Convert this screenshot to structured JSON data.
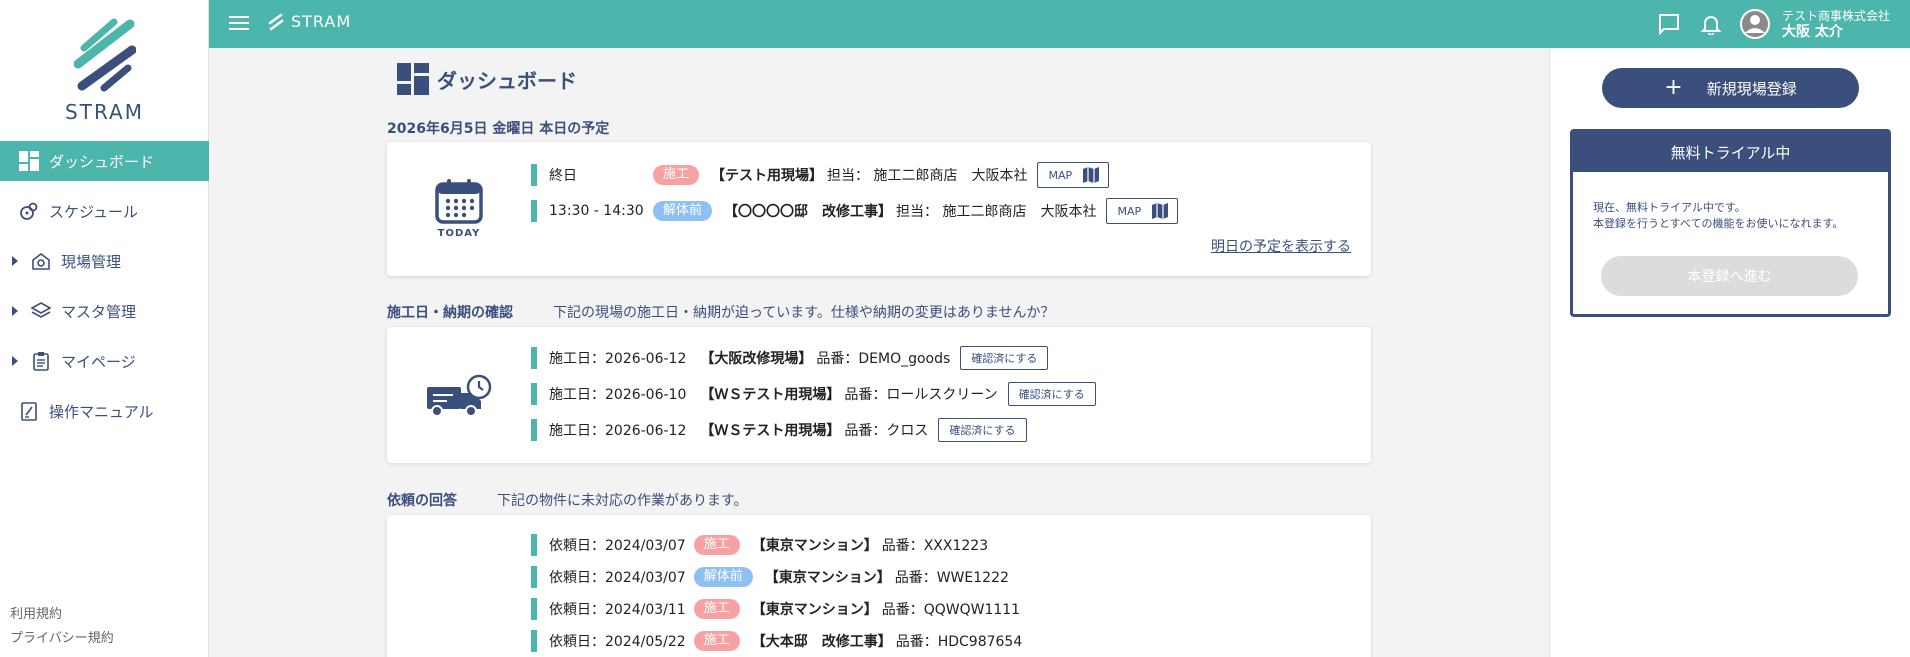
{
  "app": {
    "logo_text": "STRAM"
  },
  "sidebar": {
    "items": [
      {
        "label": "ダッシュボード",
        "icon": "dashboard-icon",
        "active": true
      },
      {
        "label": "スケジュール",
        "icon": "schedule-icon"
      },
      {
        "label": "現場管理",
        "icon": "site-gear-icon",
        "expandable": true
      },
      {
        "label": "マスタ管理",
        "icon": "layers-icon",
        "expandable": true
      },
      {
        "label": "マイページ",
        "icon": "clipboard-icon",
        "expandable": true
      },
      {
        "label": "操作マニュアル",
        "icon": "manual-icon"
      }
    ],
    "footer_links": [
      "利用規約",
      "プライバシー規約"
    ]
  },
  "topbar": {
    "logo_text": "STRAM",
    "user_company": "テスト商事株式会社",
    "user_name": "大阪 太介",
    "icons": [
      "chat-icon",
      "bell-icon",
      "user-avatar-icon"
    ]
  },
  "page": {
    "title": "ダッシュボード"
  },
  "schedule": {
    "heading": "2026年6月5日 金曜日 本日の予定",
    "icon_label": "TODAY",
    "rows": [
      {
        "time": "終日",
        "tag": "施工",
        "tag_color": "red",
        "site": "【テスト用現場】",
        "assignee": "担当： 施工二郎商店",
        "office": "大阪本社",
        "map_label": "MAP"
      },
      {
        "time": "13:30 - 14:30",
        "tag": "解体前",
        "tag_color": "blue",
        "site": "【〇〇〇〇邸　改修工事】",
        "assignee": "担当： 施工二郎商店",
        "office": "大阪本社",
        "map_label": "MAP"
      }
    ],
    "next_link": "明日の予定を表示する"
  },
  "deadline": {
    "title": "施工日・納期の確認",
    "desc": "下記の現場の施工日・納期が迫っています。仕様や納期の変更はありませんか？",
    "rows": [
      {
        "date": "施工日：2026-06-12",
        "site": "【大阪改修現場】",
        "product": "品番：DEMO_goods",
        "button": "確認済にする"
      },
      {
        "date": "施工日：2026-06-10",
        "site": "【ＷＳテスト用現場】",
        "product": "品番：ロールスクリーン",
        "button": "確認済にする"
      },
      {
        "date": "施工日：2026-06-12",
        "site": "【ＷＳテスト用現場】",
        "product": "品番：クロス",
        "button": "確認済にする"
      }
    ]
  },
  "requests": {
    "title": "依頼の回答",
    "desc": "下記の物件に未対応の作業があります。",
    "rows": [
      {
        "date": "依頼日：2024/03/07",
        "tag": "施工",
        "tag_color": "red",
        "site": "【東京マンション】",
        "product": "品番：XXX1223"
      },
      {
        "date": "依頼日：2024/03/07",
        "tag": "解体前",
        "tag_color": "blue",
        "site": "【東京マンション】",
        "product": "品番：WWE1222"
      },
      {
        "date": "依頼日：2024/03/11",
        "tag": "施工",
        "tag_color": "red",
        "site": "【東京マンション】",
        "product": "品番：QQWQW1111"
      },
      {
        "date": "依頼日：2024/05/22",
        "tag": "施工",
        "tag_color": "red",
        "site": "【大本邸　改修工事】",
        "product": "品番：HDC987654"
      }
    ]
  },
  "right_panel": {
    "new_button_label": "新規現場登録",
    "trial_title": "無料トライアル中",
    "trial_text_1": "現在、無料トライアル中です。",
    "trial_text_2": "本登録を行うとすべての機能をお使いになれます。",
    "trial_button": "本登録へ進む"
  },
  "colors": {
    "teal": "#4db6ac",
    "navy": "#3b4f7c",
    "tag_red": "#f7a2a2",
    "tag_blue": "#8fc0f2"
  }
}
